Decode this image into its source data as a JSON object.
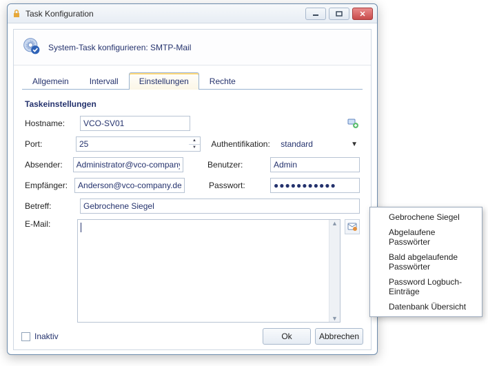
{
  "window": {
    "title": "Task Konfiguration"
  },
  "header": {
    "title": "System-Task konfigurieren: SMTP-Mail"
  },
  "tabs": {
    "general": "Allgemein",
    "interval": "Intervall",
    "settings": "Einstellungen",
    "rights": "Rechte"
  },
  "section": {
    "title": "Taskeinstellungen"
  },
  "labels": {
    "hostname": "Hostname:",
    "port": "Port:",
    "auth": "Authentifikation:",
    "sender": "Absender:",
    "user": "Benutzer:",
    "recipient": "Empfänger:",
    "password": "Passwort:",
    "subject": "Betreff:",
    "email": "E-Mail:"
  },
  "values": {
    "hostname": "VCO-SV01",
    "port": "25",
    "auth": "standard",
    "sender": "Administrator@vco-company.",
    "user": "Admin",
    "recipient": "Anderson@vco-company.de",
    "password": "●●●●●●●●●●●",
    "subject": "Gebrochene Siegel",
    "email": ""
  },
  "footer": {
    "inactive": "Inaktiv",
    "ok": "Ok",
    "cancel": "Abbrechen"
  },
  "menu": {
    "m1": "Gebrochene Siegel",
    "m2": "Abgelaufene Passwörter",
    "m3": "Bald abgelaufende Passwörter",
    "m4": "Password Logbuch-Einträge",
    "m5": "Datenbank Übersicht"
  }
}
